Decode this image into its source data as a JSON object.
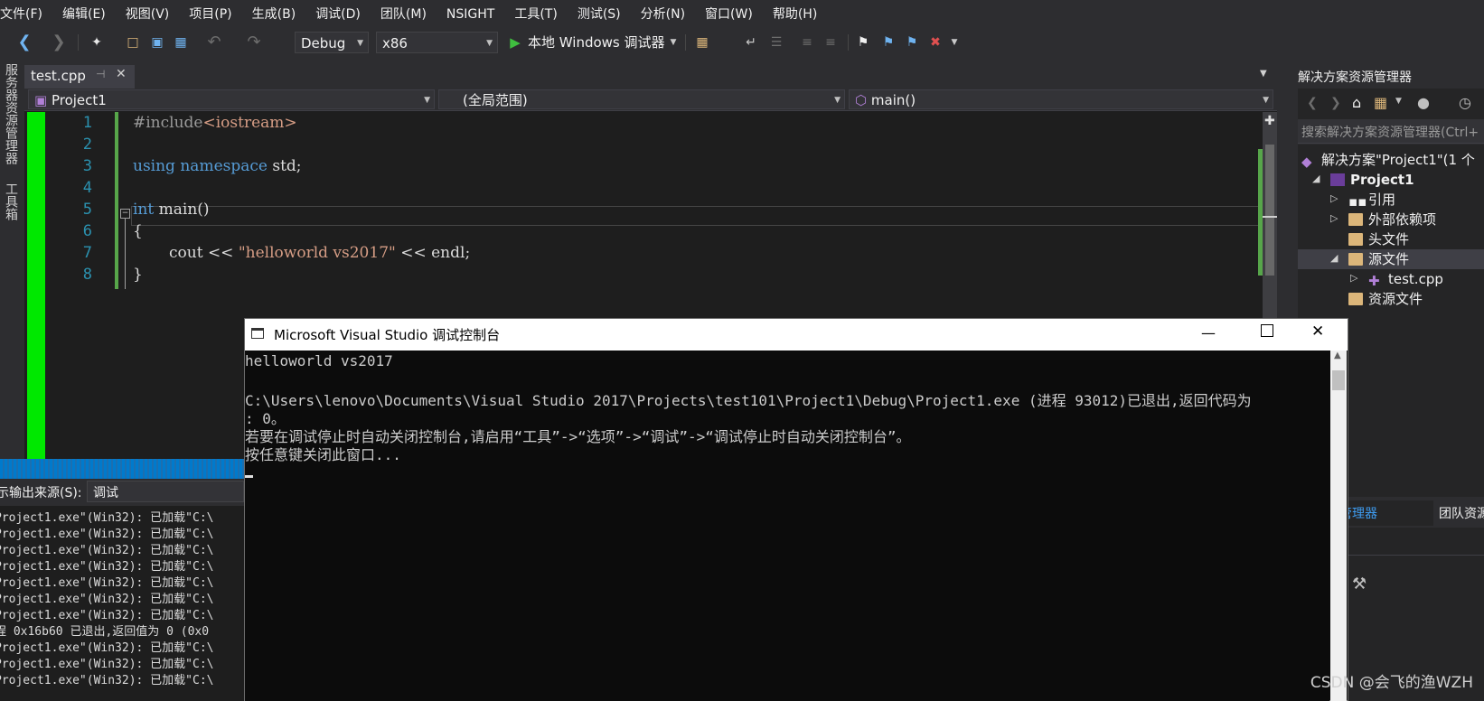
{
  "menu": [
    "文件(F)",
    "编辑(E)",
    "视图(V)",
    "项目(P)",
    "生成(B)",
    "调试(D)",
    "团队(M)",
    "NSIGHT",
    "工具(T)",
    "测试(S)",
    "分析(N)",
    "窗口(W)",
    "帮助(H)"
  ],
  "toolbar": {
    "config": "Debug",
    "platform": "x86",
    "run_label": "本地 Windows 调试器"
  },
  "side_tabs": {
    "server_explorer": "服务器资源管理器",
    "toolbox": "工具箱"
  },
  "editor": {
    "tab_label": "test.cpp",
    "project_combo": "Project1",
    "scope_combo": "(全局范围)",
    "member_combo": "main()",
    "line_numbers": [
      "1",
      "2",
      "3",
      "4",
      "5",
      "6",
      "7",
      "8"
    ]
  },
  "code": {
    "l1_pp": "#include",
    "l1_tag": "<iostream>",
    "l3_kw1": "using",
    "l3_kw2": "namespace",
    "l3_rest": " std;",
    "l5_kw": "int",
    "l5_rest": " main()",
    "l6": "{",
    "l7_a": "cout << ",
    "l7_str": "\"helloworld vs2017\"",
    "l7_b": " << endl;",
    "l8": "}"
  },
  "solution_explorer": {
    "title": "解决方案资源管理器",
    "search_placeholder": "搜索解决方案资源管理器(Ctrl+",
    "solution": "解决方案\"Project1\"(1 个",
    "project": "Project1",
    "references": "引用",
    "external_deps": "外部依赖项",
    "header_files": "头文件",
    "source_files": "源文件",
    "source_file_item": "test.cpp",
    "resource_files": "资源文件",
    "tab_se": "案资源管理器",
    "tab_team": "团队资源"
  },
  "output": {
    "source_label": "示输出来源(S):",
    "source_value": "调试",
    "lines": [
      "Project1.exe\"(Win32): 已加载\"C:\\",
      "Project1.exe\"(Win32): 已加载\"C:\\",
      "Project1.exe\"(Win32): 已加载\"C:\\",
      "Project1.exe\"(Win32): 已加载\"C:\\",
      "Project1.exe\"(Win32): 已加载\"C:\\",
      "Project1.exe\"(Win32): 已加载\"C:\\",
      "Project1.exe\"(Win32): 已加载\"C:\\",
      "程 0x16b60 已退出,返回值为 0 (0x0",
      "Project1.exe\"(Win32): 已加载\"C:\\",
      "Project1.exe\"(Win32): 已加载\"C:\\",
      "Project1.exe\"(Win32): 已加载\"C:\\"
    ]
  },
  "console": {
    "title": "Microsoft Visual Studio 调试控制台",
    "lines": [
      "helloworld vs2017",
      "",
      "C:\\Users\\lenovo\\Documents\\Visual Studio 2017\\Projects\\test101\\Project1\\Debug\\Project1.exe (进程 93012)已退出,返回代码为",
      ": 0。",
      "若要在调试停止时自动关闭控制台,请启用“工具”->“选项”->“调试”->“调试停止时自动关闭控制台”。",
      "按任意键关闭此窗口..."
    ]
  },
  "watermark": "CSDN @会飞的渔WZH"
}
